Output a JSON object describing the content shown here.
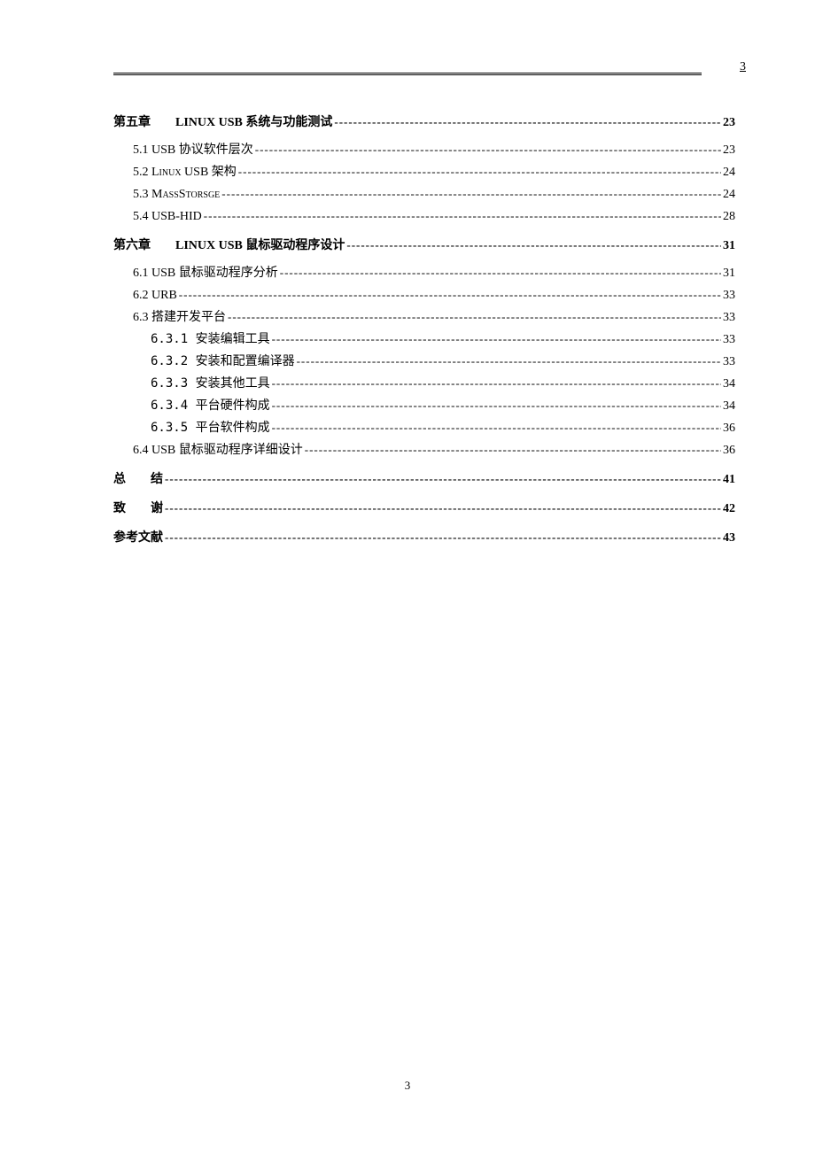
{
  "header_page": "3",
  "footer_page": "3",
  "toc": {
    "ch5": {
      "prefix": "第五章",
      "title": "LINUX USB 系统与功能测试",
      "page": "23",
      "items": {
        "s5_1": {
          "label": "5.1 USB 协议软件层次",
          "page": "23"
        },
        "s5_2_pre": "5.2 ",
        "s5_2_small": "Linux",
        "s5_2_rest": " USB 架构",
        "s5_2_page": "24",
        "s5_3_pre": "5.3 ",
        "s5_3_small": "MassStorsge",
        "s5_3_page": "24",
        "s5_4": {
          "label": "5.4 USB-HID",
          "page": "28"
        }
      }
    },
    "ch6": {
      "prefix": "第六章",
      "title": "LINUX USB 鼠标驱动程序设计",
      "page": "31",
      "items": {
        "s6_1": {
          "label": "6.1 USB 鼠标驱动程序分析",
          "page": "31"
        },
        "s6_2": {
          "label": "6.2 URB",
          "page": "33"
        },
        "s6_3": {
          "label": "6.3 搭建开发平台",
          "page": "33"
        },
        "s6_3_1": {
          "label": "6.3.1 安装编辑工具",
          "page": "33"
        },
        "s6_3_2": {
          "label": "6.3.2 安装和配置编译器",
          "page": "33"
        },
        "s6_3_3": {
          "label": "6.3.3 安装其他工具",
          "page": "34"
        },
        "s6_3_4": {
          "label": "6.3.4 平台硬件构成",
          "page": "34"
        },
        "s6_3_5": {
          "label": "6.3.5 平台软件构成",
          "page": "36"
        },
        "s6_4": {
          "label": "6.4 USB 鼠标驱动程序详细设计",
          "page": "36"
        }
      }
    },
    "conclusion": {
      "char1": "总",
      "char2": "结",
      "page": "41"
    },
    "acknowledgment": {
      "char1": "致",
      "char2": "谢",
      "page": "42"
    },
    "references": {
      "label": "参考文献",
      "page": "43"
    }
  }
}
